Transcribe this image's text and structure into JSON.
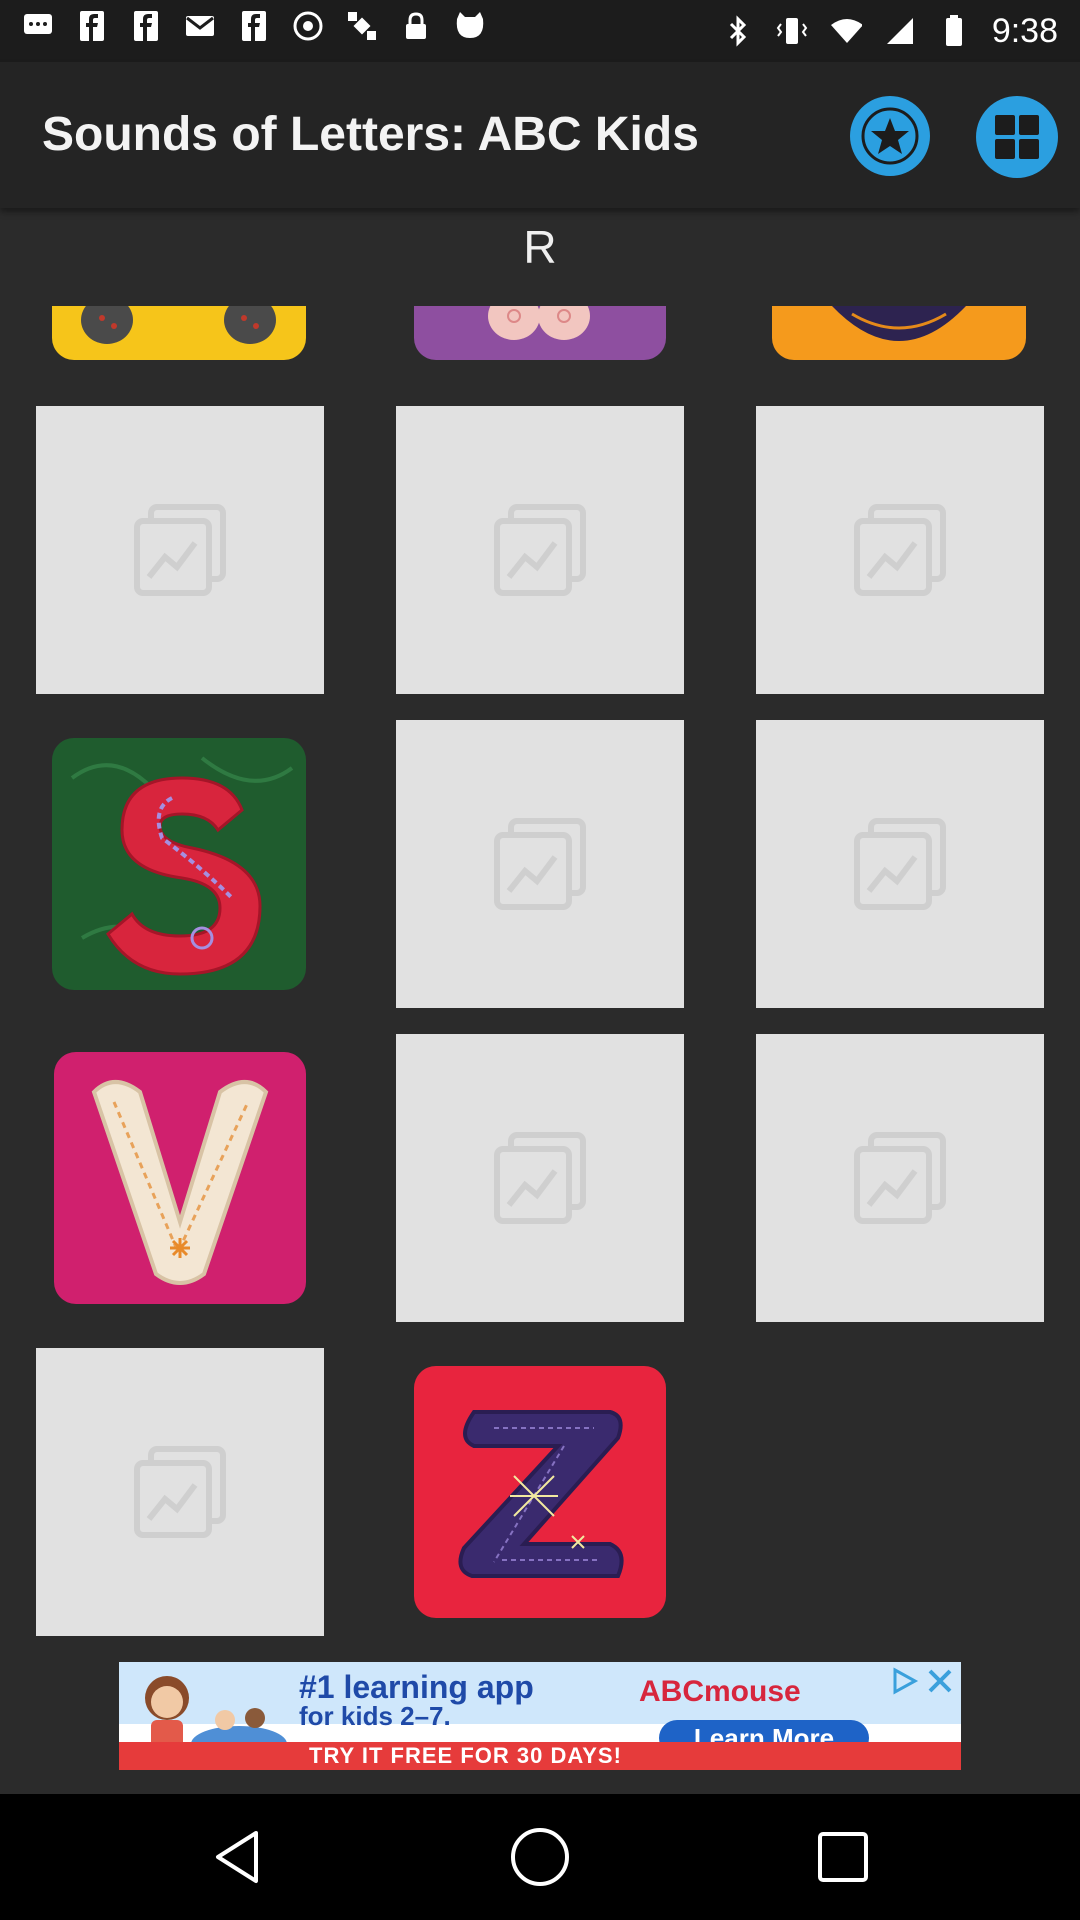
{
  "status_bar": {
    "time": "9:38",
    "left_icons": [
      "message-icon",
      "facebook-icon",
      "facebook-icon",
      "mail-icon",
      "facebook-icon",
      "vpn-icon",
      "satellite-icon",
      "lock-icon",
      "cat-icon"
    ],
    "right_icons": [
      "bluetooth-icon",
      "vibrate-icon",
      "wifi-icon",
      "signal-icon",
      "battery-icon"
    ]
  },
  "app_bar": {
    "title": "Sounds of Letters: ABC Kids",
    "favorites_icon": "star-icon",
    "grid_icon": "grid-icon",
    "accent": "#2b9fe0"
  },
  "section": {
    "header": "R"
  },
  "grid": {
    "partial_row": [
      {
        "tile": "yellow-letter-tile",
        "color": "#f6c51a"
      },
      {
        "tile": "purple-letter-tile",
        "color": "#8e4fa0"
      },
      {
        "tile": "orange-letter-tile",
        "color": "#f59a1c"
      }
    ],
    "rows": [
      [
        {
          "type": "placeholder"
        },
        {
          "type": "placeholder"
        },
        {
          "type": "placeholder"
        }
      ],
      [
        {
          "type": "letter",
          "letter": "S"
        },
        {
          "type": "placeholder"
        },
        {
          "type": "placeholder"
        }
      ],
      [
        {
          "type": "letter",
          "letter": "V"
        },
        {
          "type": "placeholder"
        },
        {
          "type": "placeholder"
        }
      ],
      [
        {
          "type": "placeholder"
        },
        {
          "type": "letter",
          "letter": "Z"
        }
      ]
    ]
  },
  "ad": {
    "headline": "#1 learning app",
    "subline": "for kids 2–7.",
    "brand": "ABCmouse",
    "cta": "Learn More",
    "promo": "TRY IT FREE FOR 30 DAYS!"
  },
  "nav_bar": {
    "icons": [
      "back-icon",
      "home-icon",
      "recents-icon"
    ]
  }
}
